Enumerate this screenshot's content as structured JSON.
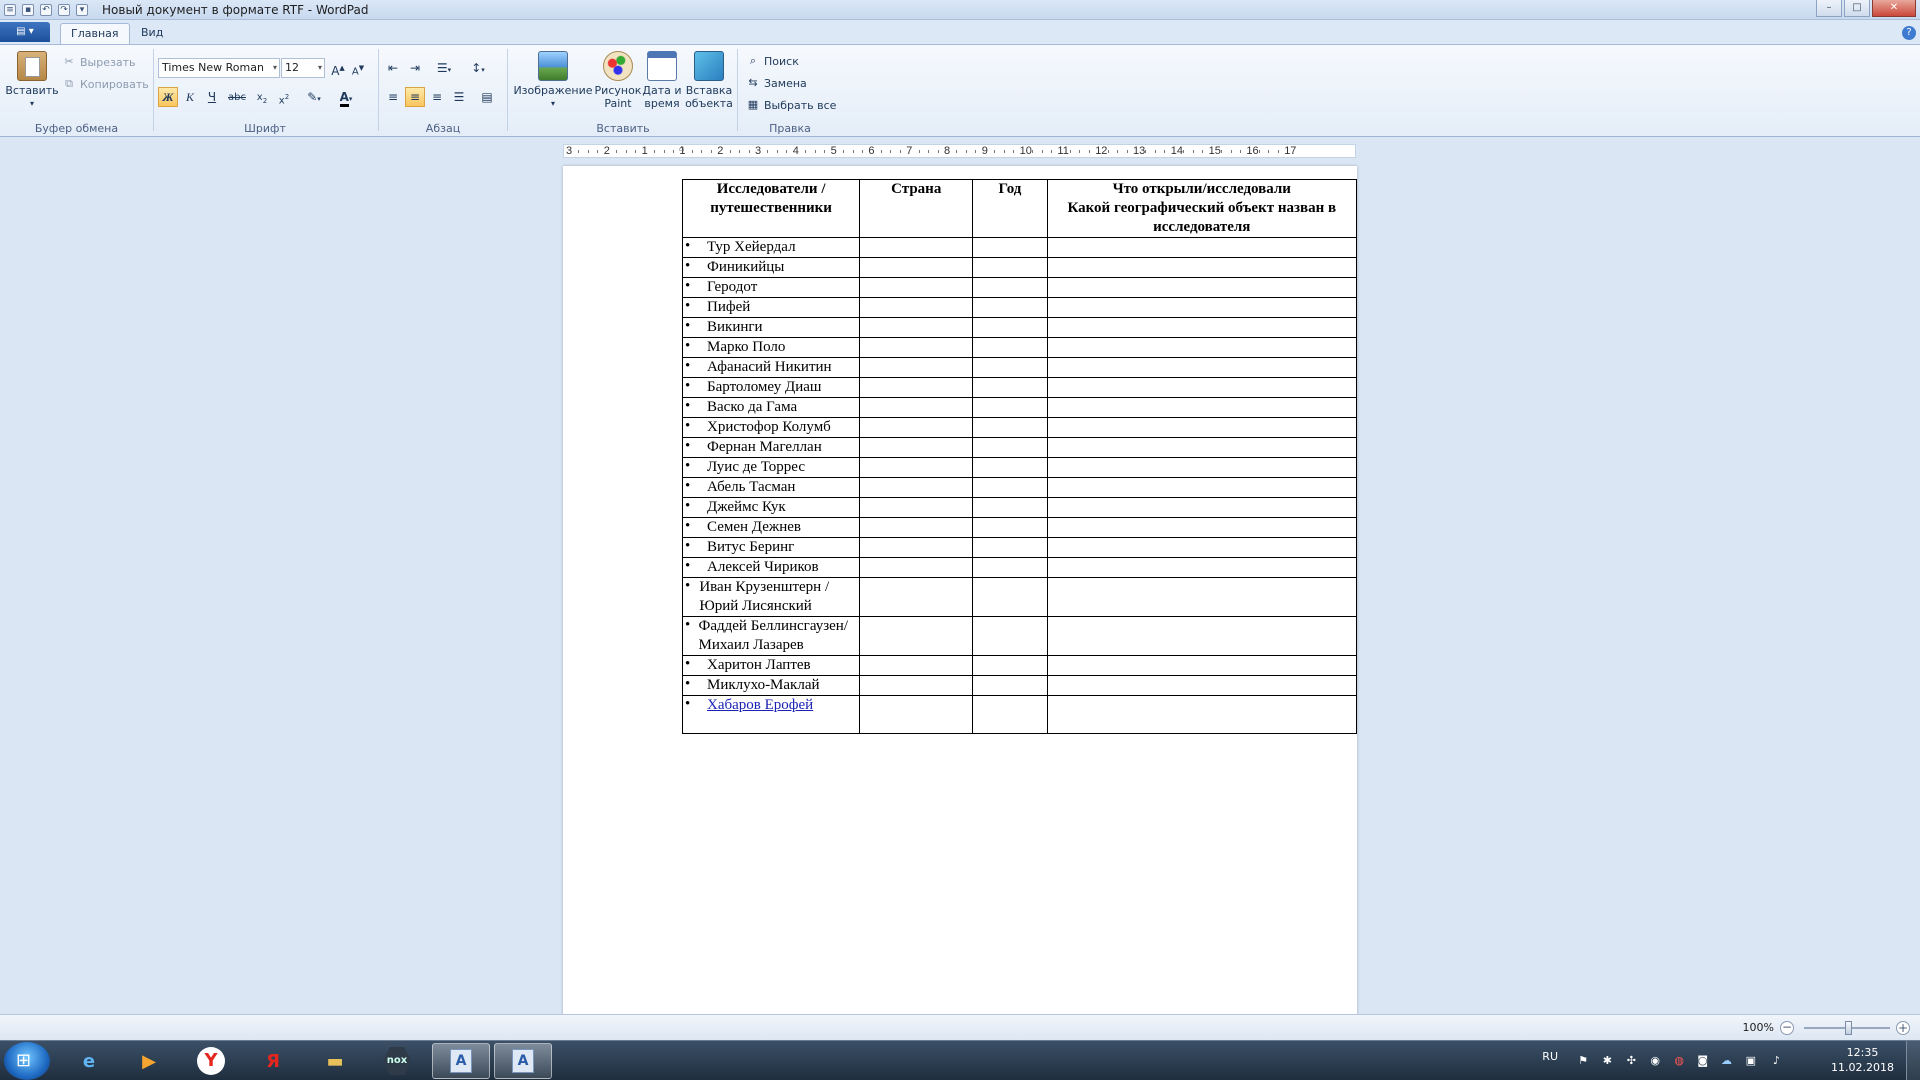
{
  "window": {
    "title": "Новый документ в формате RTF - WordPad"
  },
  "tabs": [
    {
      "label": "Главная"
    },
    {
      "label": "Вид"
    }
  ],
  "clipboard": {
    "paste_label": "Вставить",
    "cut_label": "Вырезать",
    "copy_label": "Копировать",
    "group_label": "Буфер обмена"
  },
  "font": {
    "family": "Times New Roman",
    "size": "12",
    "group_label": "Шрифт",
    "bold_glyph": "Ж",
    "italic_glyph": "К",
    "underline_glyph": "Ч",
    "strike_glyph": "abc"
  },
  "paragraph": {
    "group_label": "Абзац"
  },
  "insert": {
    "group_label": "Вставить",
    "picture_label": "Изображение",
    "paint_label_1": "Рисунок",
    "paint_label_2": "Paint",
    "datetime_label_1": "Дата и",
    "datetime_label_2": "время",
    "object_label_1": "Вставка",
    "object_label_2": "объекта"
  },
  "editing": {
    "group_label": "Правка",
    "find_label": "Поиск",
    "replace_label": "Замена",
    "select_all_label": "Выбрать все"
  },
  "ruler": {
    "labels": [
      "3",
      "2",
      "1",
      "1",
      "2",
      "3",
      "4",
      "5",
      "6",
      "7",
      "8",
      "9",
      "10",
      "11",
      "12",
      "13",
      "14",
      "15",
      "16",
      "17"
    ]
  },
  "table": {
    "headers": {
      "col1": "Исследователи / путешественники",
      "col2": "Страна",
      "col3": "Год",
      "col4_line1": "Что открыли/исследовали",
      "col4_line2": "Какой географический объект назван в",
      "col4_line3": "исследователя"
    },
    "bullet": "•",
    "rows": [
      "Тур Хейердал",
      "Финикийцы",
      "Геродот",
      "Пифей",
      "Викинги",
      "Марко Поло",
      "Афанасий Никитин",
      "Бартоломеу Диаш",
      "Васко да Гама",
      "Христофор Колумб",
      "Фернан Магеллан",
      "Луис де Торрес",
      "Абель Тасман",
      "Джеймс Кук",
      "Семен Дежнев",
      "Витус Беринг",
      "Алексей Чириков",
      "Иван Крузенштерн /Юрий Лисянский",
      "Фаддей Беллинсгаузен/ Михаил Лазарев",
      "Харитон Лаптев",
      "Миклухо-Маклай",
      "Хабаров Ерофей"
    ]
  },
  "statusbar": {
    "zoom": "100%"
  },
  "taskbar": {
    "language": "RU",
    "time": "12:35",
    "date": "11.02.2018",
    "nox_label": "nox",
    "yandex_label": "Я"
  }
}
